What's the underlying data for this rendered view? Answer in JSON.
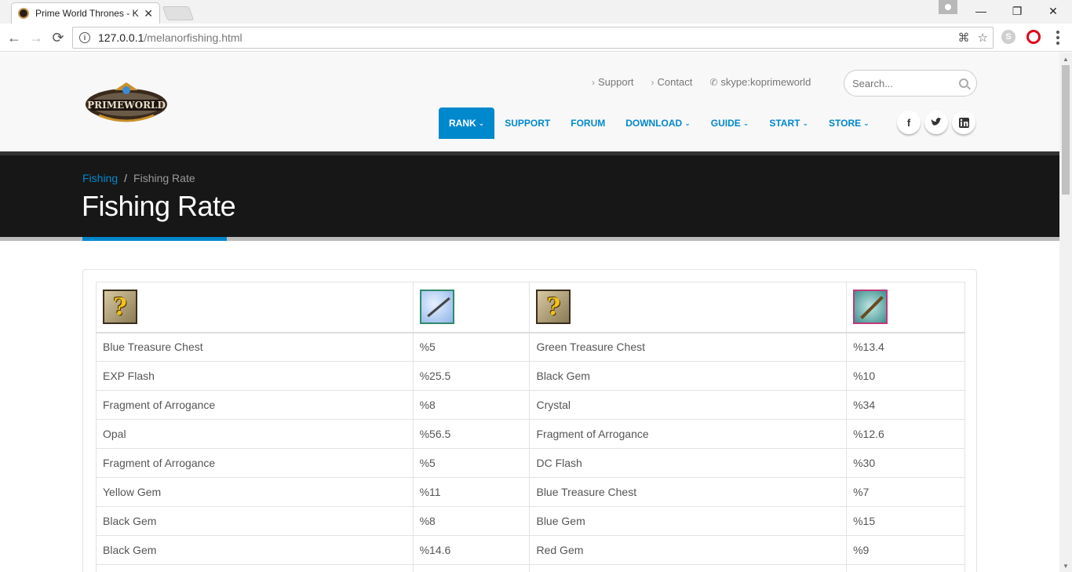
{
  "browser": {
    "tab_title": "Prime World Thrones - K",
    "tab_close": "✕",
    "url_host": "127.0.0.1",
    "url_path": "/melanorfishing.html",
    "back": "←",
    "forward": "→",
    "reload": "⟳",
    "minimize": "—",
    "restore": "❐",
    "close": "✕"
  },
  "header": {
    "logo_text": "PRIMEWORLD",
    "top_links": [
      {
        "label": "Support"
      },
      {
        "label": "Contact"
      },
      {
        "label": "skype:koprimeworld"
      }
    ],
    "search_placeholder": "Search...",
    "nav": [
      {
        "label": "RANK",
        "active": true,
        "caret": true
      },
      {
        "label": "SUPPORT",
        "active": false,
        "caret": false
      },
      {
        "label": "FORUM",
        "active": false,
        "caret": false
      },
      {
        "label": "DOWNLOAD",
        "active": false,
        "caret": true
      },
      {
        "label": "GUIDE",
        "active": false,
        "caret": true
      },
      {
        "label": "START",
        "active": false,
        "caret": true
      },
      {
        "label": "STORE",
        "active": false,
        "caret": true
      }
    ],
    "social": [
      "f",
      "t",
      "in"
    ]
  },
  "breadcrumb": {
    "parent": "Fishing",
    "separator": "/",
    "current": "Fishing Rate"
  },
  "page_title": "Fishing Rate",
  "table": {
    "header_icons": [
      "question-box-icon",
      "fishing-rod-icon",
      "question-box-icon",
      "golden-fishing-rod-icon"
    ],
    "rows": [
      [
        "Blue Treasure Chest",
        "%5",
        "Green Treasure Chest",
        "%13.4"
      ],
      [
        "EXP Flash",
        "%25.5",
        "Black Gem",
        "%10"
      ],
      [
        "Fragment of Arrogance",
        "%8",
        "Crystal",
        "%34"
      ],
      [
        "Opal",
        "%56.5",
        "Fragment of Arrogance",
        "%12.6"
      ],
      [
        "Fragment of Arrogance",
        "%5",
        "DC Flash",
        "%30"
      ],
      [
        "Yellow Gem",
        "%11",
        "Blue Treasure Chest",
        "%7"
      ],
      [
        "Black Gem",
        "%8",
        "Blue Gem",
        "%15"
      ],
      [
        "Black Gem",
        "%14.6",
        "Red Gem",
        "%9"
      ]
    ]
  },
  "colors": {
    "accent": "#0088cc",
    "band": "#171717",
    "header_bg": "#f8f8f8"
  }
}
